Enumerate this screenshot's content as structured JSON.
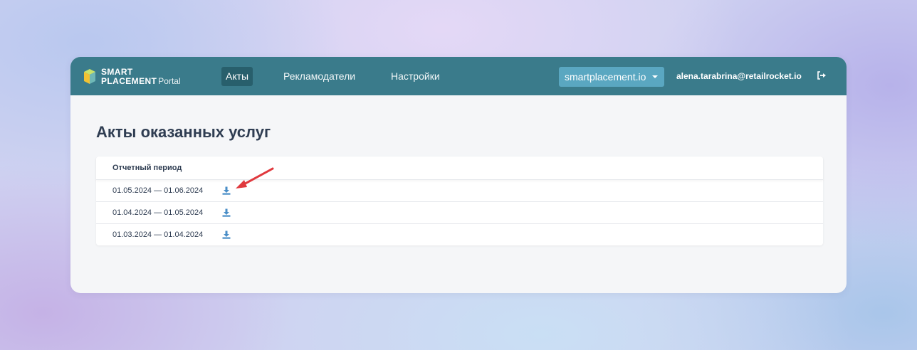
{
  "header": {
    "logo_line1": "SMART",
    "logo_line2": "PLACEMENT",
    "logo_suffix": "Portal",
    "nav": [
      {
        "label": "Акты",
        "active": true
      },
      {
        "label": "Рекламодатели",
        "active": false
      },
      {
        "label": "Настройки",
        "active": false
      }
    ],
    "domain_selector": "smartplacement.io",
    "user_email": "alena.tarabrina@retailrocket.io",
    "logout_icon": "sign-out-icon"
  },
  "main": {
    "title": "Акты оказанных услуг",
    "table": {
      "header": "Отчетный период",
      "rows": [
        {
          "period": "01.05.2024 — 01.06.2024",
          "icon": "download-icon"
        },
        {
          "period": "01.04.2024 — 01.05.2024",
          "icon": "download-icon"
        },
        {
          "period": "01.03.2024 — 01.04.2024",
          "icon": "download-icon"
        }
      ]
    }
  },
  "colors": {
    "navbar": "#3a7b8b",
    "nav_active": "#285f6c",
    "domain_button": "#5aa7c1",
    "download_icon": "#4a8ec7",
    "annotation_arrow": "#e0393e"
  }
}
